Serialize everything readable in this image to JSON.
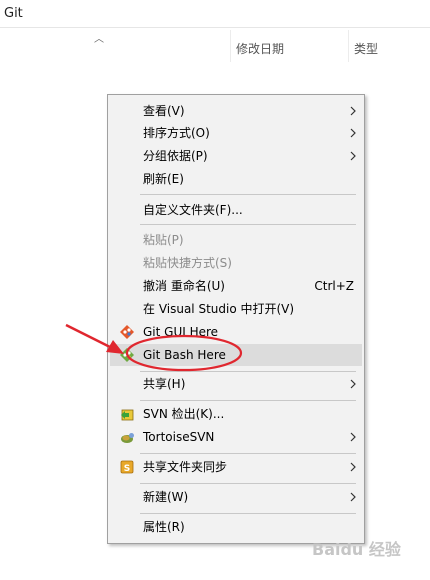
{
  "window": {
    "folder_title": "Git"
  },
  "columns": {
    "modified": "修改日期",
    "type": "类型"
  },
  "menu": {
    "items": [
      {
        "label": "查看(V)"
      },
      {
        "label": "排序方式(O)"
      },
      {
        "label": "分组依据(P)"
      },
      {
        "label": "刷新(E)"
      },
      {
        "label": "自定义文件夹(F)..."
      },
      {
        "label": "粘贴(P)"
      },
      {
        "label": "粘贴快捷方式(S)"
      },
      {
        "label": "撤消 重命名(U)",
        "shortcut": "Ctrl+Z"
      },
      {
        "label": "在 Visual Studio 中打开(V)"
      },
      {
        "label": "Git GUI Here"
      },
      {
        "label": "Git Bash Here"
      },
      {
        "label": "共享(H)"
      },
      {
        "label": "SVN 检出(K)..."
      },
      {
        "label": "TortoiseSVN"
      },
      {
        "label": "共享文件夹同步"
      },
      {
        "label": "新建(W)"
      },
      {
        "label": "属性(R)"
      }
    ]
  },
  "annotation": {
    "color": "#e0272f"
  },
  "watermark": {
    "text": "Baidu 经验"
  }
}
